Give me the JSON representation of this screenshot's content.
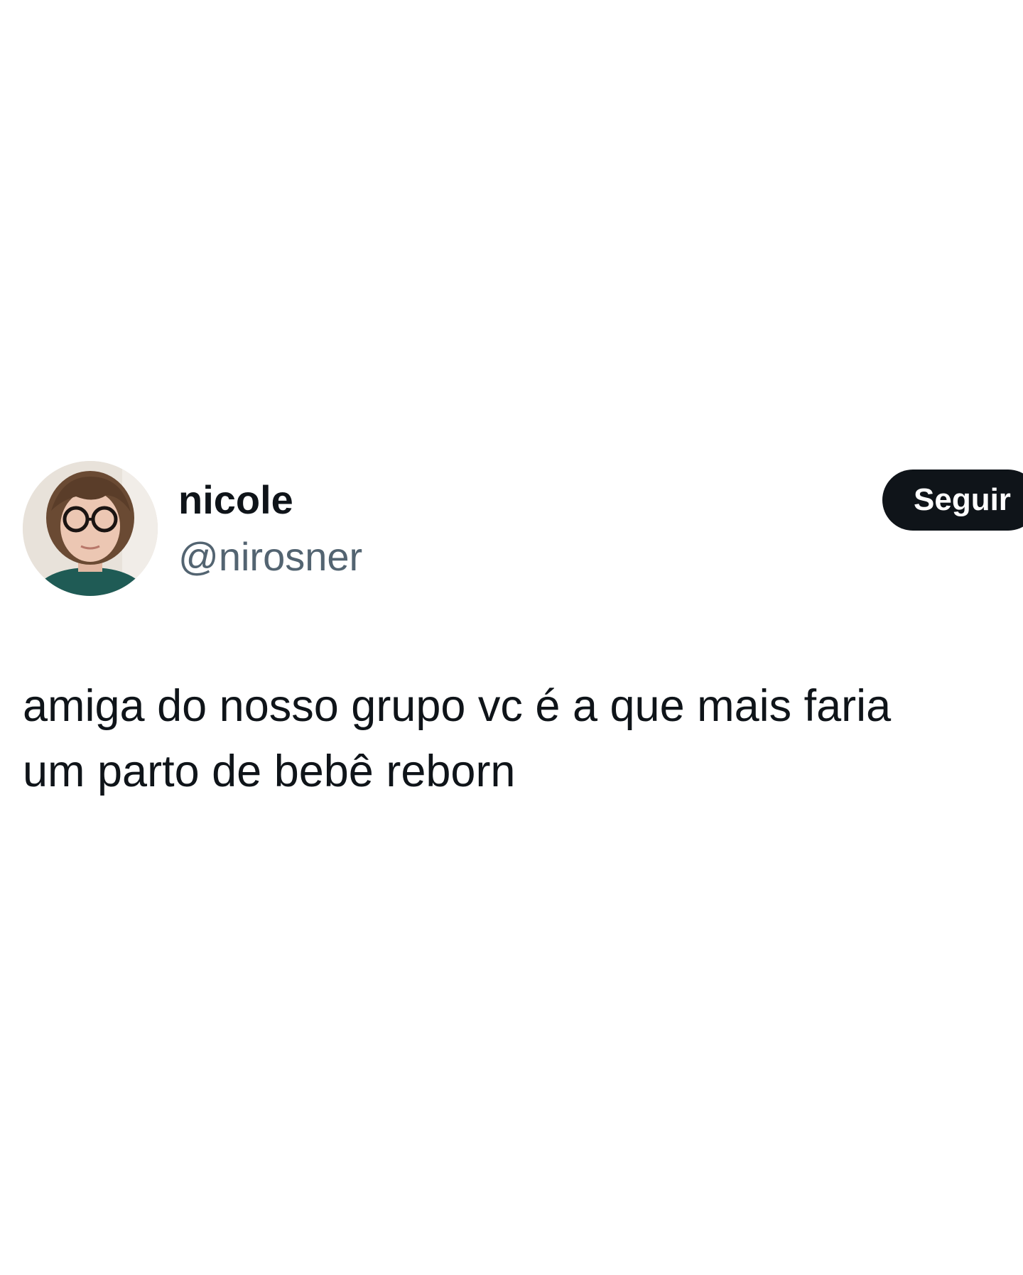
{
  "tweet": {
    "author": {
      "display_name": "nicole",
      "handle": "@nirosner"
    },
    "follow_label": "Seguir",
    "text_lines": [
      "amiga do nosso grupo vc é a que mais faria",
      "um parto de bebê reborn"
    ]
  },
  "colors": {
    "background": "#ffffff",
    "text_primary": "#0f1419",
    "text_secondary": "#536471",
    "button_background": "#0f1419",
    "button_text": "#ffffff"
  }
}
